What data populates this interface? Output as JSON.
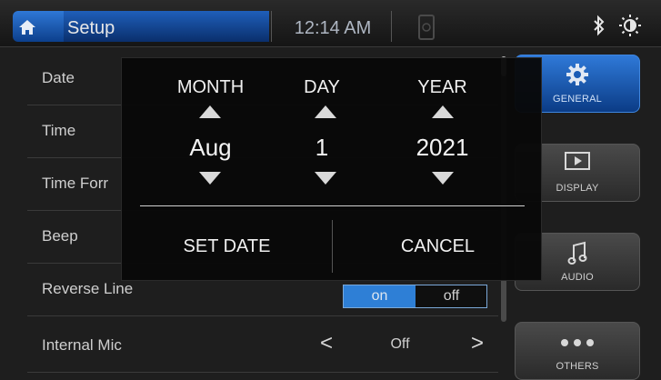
{
  "header": {
    "title": "Setup",
    "clock": "12:14 AM"
  },
  "settings": {
    "rows": [
      {
        "label": "Date"
      },
      {
        "label": "Time"
      },
      {
        "label": "Time Forr"
      },
      {
        "label": "Beep"
      },
      {
        "label": "Reverse Line"
      },
      {
        "label": "Internal Mic"
      }
    ],
    "reverse_line": {
      "on_label": "on",
      "off_label": "off",
      "selected": "on"
    },
    "internal_mic": {
      "value": "Off",
      "prev_symbol": "<",
      "next_symbol": ">"
    }
  },
  "categories": [
    {
      "label": "GENERAL",
      "icon": "gear-icon",
      "active": true
    },
    {
      "label": "DISPLAY",
      "icon": "display-icon",
      "active": false
    },
    {
      "label": "AUDIO",
      "icon": "music-note-icon",
      "active": false
    },
    {
      "label": "OTHERS",
      "icon": "more-dots-icon",
      "active": false
    }
  ],
  "date_dialog": {
    "month": {
      "label": "MONTH",
      "value": "Aug"
    },
    "day": {
      "label": "DAY",
      "value": "1"
    },
    "year": {
      "label": "YEAR",
      "value": "2021"
    },
    "confirm_label": "SET DATE",
    "cancel_label": "CANCEL"
  },
  "colors": {
    "accent_blue": "#2e7fd6",
    "background": "#1e1e1e",
    "dialog_background": "#080808"
  }
}
